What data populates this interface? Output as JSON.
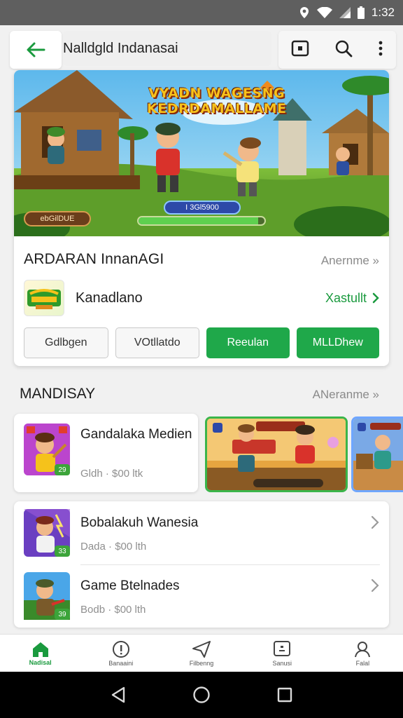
{
  "status_bar": {
    "time": "1:32"
  },
  "top_bar": {
    "title": "Nalldgld Indanasai"
  },
  "feature": {
    "banner": {
      "headline_line1": "VYADN WAGESNG",
      "headline_line2": "KEDRDAMALLAME",
      "pill_text": "I 3Gl5900",
      "badge_text": "ebGilDUE",
      "progress": 0.95
    },
    "title": "ARDARAN InnanAGI",
    "more_label": "Anernme »",
    "developer": {
      "name": "Kanadlano",
      "link_label": "Xastullt"
    },
    "buttons": [
      "Gdlbgen",
      "VOtllatdo",
      "Reeulan",
      "MLLDhew"
    ]
  },
  "section": {
    "title": "MANDISAY",
    "more_label": "ANeranme »",
    "card": {
      "name": "Gandalaka Medien",
      "meta": "Gldh · $00 ltk",
      "rating": "29"
    },
    "list": [
      {
        "name": "Bobalakuh Wanesia",
        "meta": "Dada · $00 lth",
        "rating": "33"
      },
      {
        "name": "Game Btelnades",
        "meta": "Bodb · $00 lth",
        "rating": "39"
      }
    ]
  },
  "bottom_nav": [
    {
      "label": "Nadisal",
      "icon": "home-icon",
      "active": true
    },
    {
      "label": "Banaaini",
      "icon": "info-icon",
      "active": false
    },
    {
      "label": "Filbenng",
      "icon": "send-icon",
      "active": false
    },
    {
      "label": "Sanusi",
      "icon": "tv-icon",
      "active": false
    },
    {
      "label": "Falal",
      "icon": "profile-icon",
      "active": false
    }
  ],
  "colors": {
    "accent": "#1fa84a",
    "link": "#1a9a3e",
    "status_bar": "#5f5f5f"
  }
}
